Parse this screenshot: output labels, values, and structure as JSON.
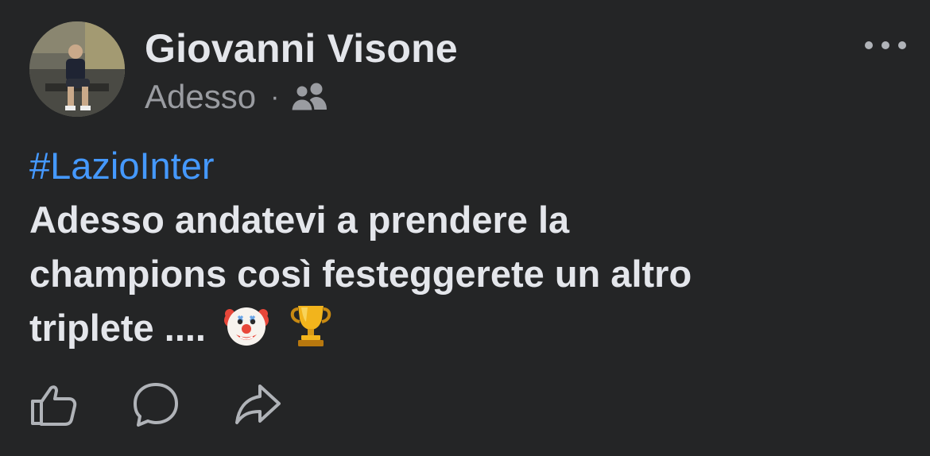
{
  "post": {
    "author": "Giovanni Visone",
    "timestamp": "Adesso",
    "separator": "·",
    "audience_icon": "friends-icon",
    "hashtag": "#LazioInter",
    "text_lines": [
      "Adesso andatevi a prendere la",
      "champions così festeggerete un altro",
      "triplete ...."
    ],
    "emojis": [
      "clown-face-emoji",
      "trophy-emoji"
    ]
  },
  "actions": [
    {
      "name": "like",
      "icon": "thumbs-up-icon"
    },
    {
      "name": "comment",
      "icon": "comment-bubble-icon"
    },
    {
      "name": "share",
      "icon": "share-arrow-icon"
    }
  ],
  "colors": {
    "background": "#242526",
    "primary_text": "#e4e6eb",
    "secondary_text": "#9a9ca1",
    "hashtag": "#4599ff"
  }
}
